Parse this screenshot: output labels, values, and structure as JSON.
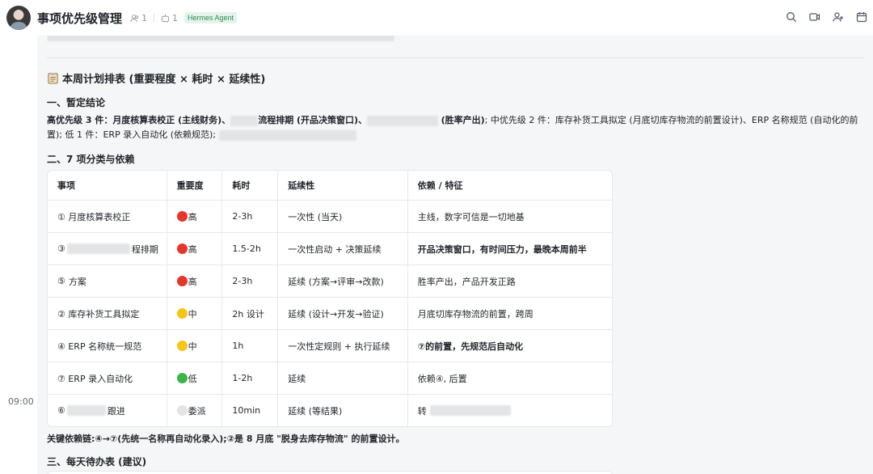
{
  "header": {
    "title": "事项优先级管理",
    "members_count": "1",
    "bots_count": "1",
    "tag": "Hermes Agent",
    "icons": [
      "search-icon",
      "video-icon",
      "add-member-icon",
      "calendar-icon"
    ]
  },
  "message": {
    "time": "09:00",
    "section_title": "本周计划排表 (重要程度 × 耗时 × 延续性)",
    "h_conclusion": "一、暂定结论",
    "conclusion_lead": "高优先级 3 件：月度核算表校正 (主线财务)、",
    "conclusion_a": "流程排期 (开品决策窗口)、",
    "conclusion_b": "(胜率产出)",
    "conclusion_rest": "; 中优先级 2 件：库存补货工具拟定 (月底切库存物流的前置设计)、ERP 名称规范 (自动化的前置); 低 1 件：ERP 录入自动化 (依赖规范);",
    "h_classify": "二、7 项分类与依赖",
    "table": {
      "headers": [
        "事项",
        "重要度",
        "耗时",
        "延续性",
        "依赖 / 特征"
      ],
      "rows": [
        {
          "item": "① 月度核算表校正",
          "level": "高",
          "level_color": "#e8352c",
          "time": "2-3h",
          "cont": "一次性 (当天)",
          "dep": "主线，数字可信是一切地基",
          "dep_bold": false
        },
        {
          "item_pre": "③",
          "item": "程排期",
          "level": "高",
          "level_color": "#e8352c",
          "time": "1.5-2h",
          "cont": "一次性启动 + 决策延续",
          "dep": "开品决策窗口，有时间压力，最晚本周前半",
          "dep_bold": true
        },
        {
          "item_pre": "⑤",
          "item": "方案",
          "level": "高",
          "level_color": "#e8352c",
          "time": "2-3h",
          "cont": "延续 (方案→评审→改款)",
          "dep": "胜率产出，产品开发正路",
          "dep_bold": false
        },
        {
          "item": "② 库存补货工具拟定",
          "level": "中",
          "level_color": "#f5c518",
          "time": "2h 设计",
          "cont": "延续 (设计→开发→验证)",
          "dep": "月底切库存物流的前置，跨周",
          "dep_bold": false
        },
        {
          "item": "④ ERP 名称统一规范",
          "level": "中",
          "level_color": "#f5c518",
          "time": "1h",
          "cont": "一次性定规则 + 执行延续",
          "dep": "⑦的前置，先规范后自动化",
          "dep_bold": true
        },
        {
          "item": "⑦ ERP 录入自动化",
          "level": "低",
          "level_color": "#3cb54a",
          "time": "1-2h",
          "cont": "延续",
          "dep": "依赖④, 后置",
          "dep_bold": false
        },
        {
          "item_pre": "⑥",
          "item": "跟进",
          "level": "委派",
          "level_color": "#e4e4e4",
          "time": "10min",
          "cont": "延续 (等结果)",
          "dep": "转",
          "dep_bold": false
        }
      ]
    },
    "note": "关键依赖链:④→⑦(先统一名称再自动化录入);②是 8 月底 \"脱身去库存物流\" 的前置设计。",
    "h_daily": "三、每天待办表 (建议)"
  }
}
